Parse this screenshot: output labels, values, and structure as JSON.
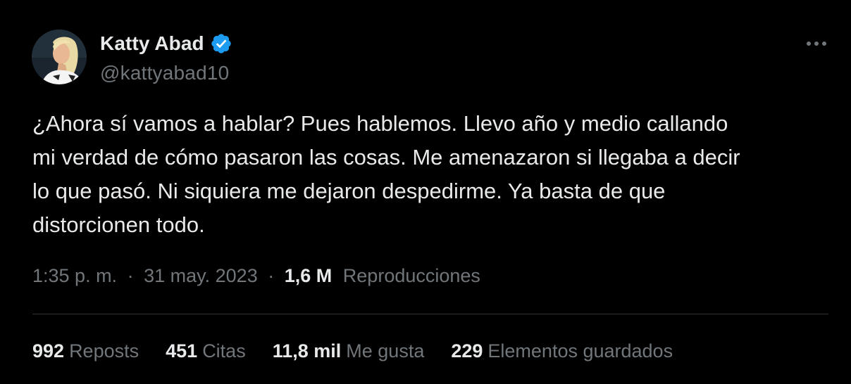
{
  "author": {
    "display_name": "Katty Abad",
    "handle": "@kattyabad10",
    "verified_icon": "verified-badge-icon",
    "verified_color": "#1d9bf0"
  },
  "tweet": {
    "text": "¿Ahora sí vamos a hablar? Pues hablemos. Llevo año y medio callando\nmi verdad de cómo pasaron las cosas. Me amenazaron si llegaba a decir\nlo que pasó. Ni siquiera me dejaron despedirme. Ya basta de que\ndistorcionen todo."
  },
  "meta": {
    "time": "1:35 p. m.",
    "separator": "·",
    "date": "31 may. 2023",
    "views_count": "1,6 M",
    "views_label": "Reproducciones"
  },
  "stats": [
    {
      "count": "992",
      "label": "Reposts"
    },
    {
      "count": "451",
      "label": "Citas"
    },
    {
      "count": "11,8 mil",
      "label": "Me gusta"
    },
    {
      "count": "229",
      "label": "Elementos guardados"
    }
  ],
  "icons": {
    "more": "more-options-icon"
  },
  "colors": {
    "background": "#000000",
    "text_primary": "#e7e9ea",
    "text_secondary": "#71767b",
    "divider": "#2f3336",
    "accent": "#1d9bf0"
  }
}
